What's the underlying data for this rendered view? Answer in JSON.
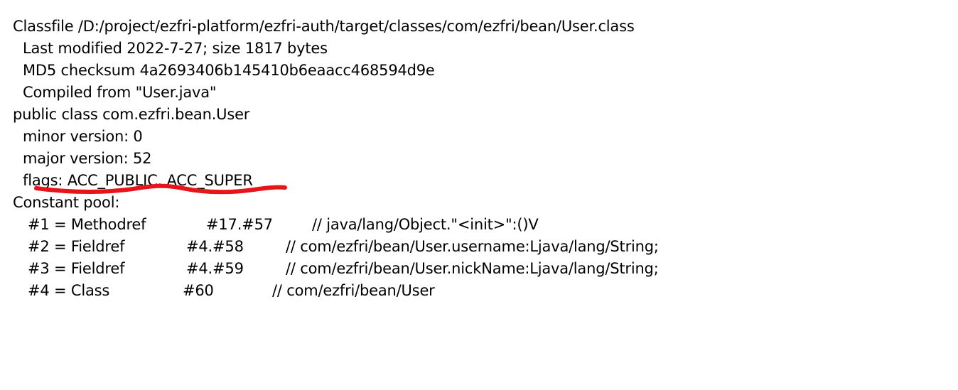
{
  "header": {
    "classfile": "Classfile /D:/project/ezfri-platform/ezfri-auth/target/classes/com/ezfri/bean/User.class",
    "last_modified": "Last modified 2022-7-27; size 1817 bytes",
    "md5": "MD5 checksum 4a2693406b145410b6eaacc468594d9e",
    "compiled_from": "Compiled from \"User.java\""
  },
  "class_info": {
    "declaration": "public class com.ezfri.bean.User",
    "minor_version": "minor version: 0",
    "major_version": "major version: 52",
    "flags": "flags: ACC_PUBLIC, ACC_SUPER"
  },
  "constant_pool": {
    "title": "Constant pool:",
    "entries": [
      {
        "index": "#1 = Methodref",
        "ref": "#17.#57",
        "comment": "// java/lang/Object.\"<init>\":()V"
      },
      {
        "index": "#2 = Fieldref",
        "ref": "#4.#58",
        "comment": "// com/ezfri/bean/User.username:Ljava/lang/String;"
      },
      {
        "index": "#3 = Fieldref",
        "ref": "#4.#59",
        "comment": "// com/ezfri/bean/User.nickName:Ljava/lang/String;"
      },
      {
        "index": "#4 = Class",
        "ref": "#60",
        "comment": "// com/ezfri/bean/User"
      }
    ]
  },
  "annotation": {
    "color": "#e8141c"
  }
}
